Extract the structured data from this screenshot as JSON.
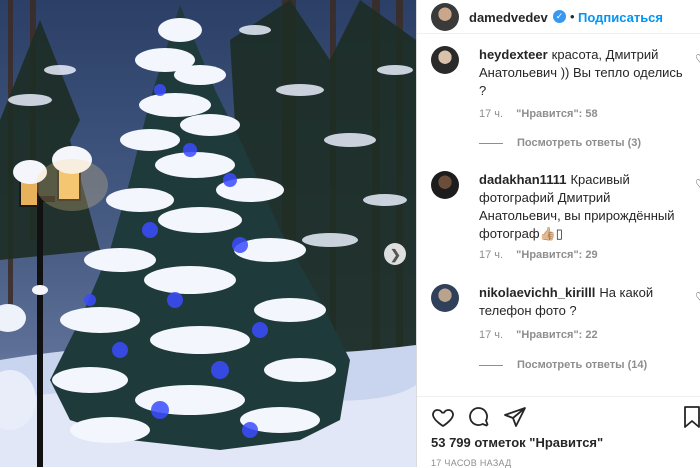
{
  "post": {
    "image_alt": "Snow-covered fir tree with blue lights and a street lamp in a snowy forest",
    "next_icon": "chevron-right-icon"
  },
  "header": {
    "username": "damedvedev",
    "verified_icon": "verified-badge-icon",
    "separator": "•",
    "follow_label": "Подписаться"
  },
  "comments": [
    {
      "username": "heydexteer",
      "text": "красота, Дмитрий Анатольевич )) Вы тепло оделись ?",
      "time": "17 ч.",
      "likes": "\"Нравится\": 58",
      "replies": "Посмотреть ответы (3)"
    },
    {
      "username": "dadakhan1111",
      "text": "Красивый фотографий Дмитрий Анатольевич, вы прирождённый фотограф👍🏼▯",
      "time": "17 ч.",
      "likes": "\"Нравится\": 29",
      "replies": ""
    },
    {
      "username": "nikolaevichh_kirilll",
      "text": "На какой телефон фото ?",
      "time": "17 ч.",
      "likes": "\"Нравится\": 22",
      "replies": "Посмотреть ответы (14)"
    }
  ],
  "footer": {
    "likes_count": "53 799 отметок \"Нравится\"",
    "time_ago": "17 ЧАСОВ НАЗАД"
  },
  "colors": {
    "link": "#0095f6",
    "verified": "#3897f0",
    "muted": "#8e8e8e",
    "text": "#262626"
  }
}
